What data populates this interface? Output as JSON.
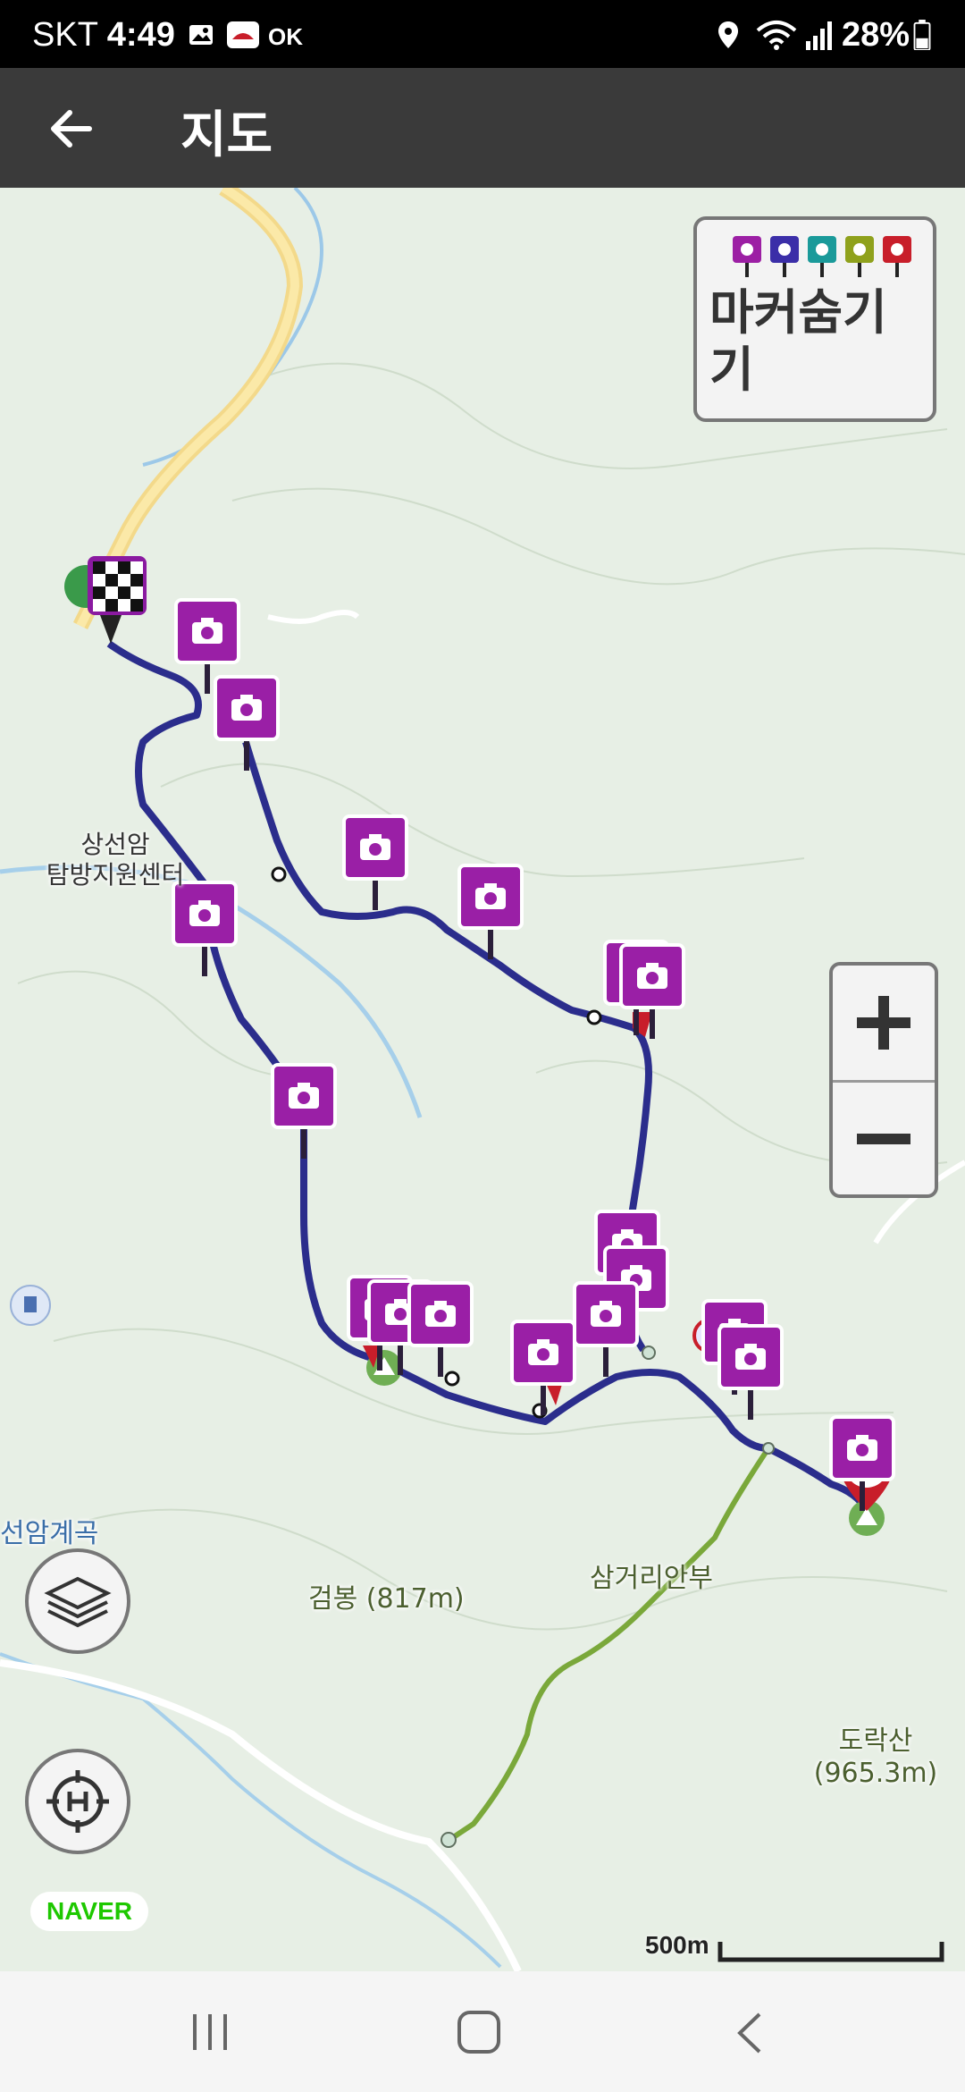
{
  "status": {
    "carrier": "SKT",
    "time": "4:49",
    "extra": "OK",
    "battery": "28%"
  },
  "appbar": {
    "title": "지도"
  },
  "marker_toggle": {
    "label": "마커숨기기",
    "colors": [
      "#9c1fa4",
      "#3b2ea8",
      "#1a9a9a",
      "#8fa11c",
      "#c81e2a"
    ]
  },
  "labels": {
    "start": "상선암\n탐방지원센터",
    "valley": "선암계곡",
    "peak1": "검봉 (817m)",
    "junction": "삼거리안부",
    "peak2": "도락산\n(965.3m)"
  },
  "zoom": {
    "plus": "+",
    "minus": "−"
  },
  "naver": "NAVER",
  "scale": "500m"
}
